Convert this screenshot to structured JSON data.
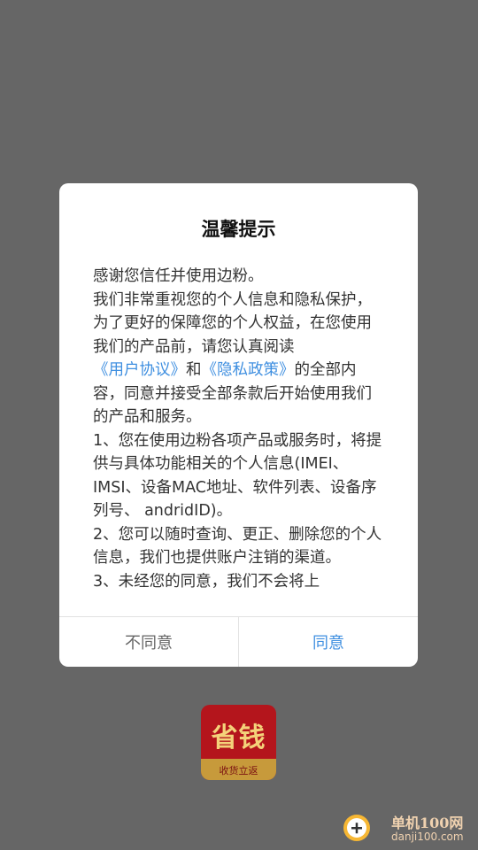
{
  "dialog": {
    "title": "温馨提示",
    "paragraphs": [
      {
        "text": "感谢您信任并使用边粉。"
      },
      {
        "text_before": "我们非常重视您的个人信息和隐私保护，为了更好的保障您的个人权益，在您使用我们的产品前，请您认真阅读",
        "link1": "《用户协议》",
        "middle": "和",
        "link2": "《隐私政策》",
        "text_after": "的全部内容，同意并接受全部条款后开始使用我们的产品和服务。"
      },
      {
        "text": "1、您在使用边粉各项产品或服务时，将提供与具体功能相关的个人信息(IMEI、IMSI、设备MAC地址、软件列表、设备序列号、 andridID)。"
      },
      {
        "text": "2、您可以随时查询、更正、删除您的个人信息，我们也提供账户注销的渠道。"
      },
      {
        "text": "3、未经您的同意，我们不会将上"
      }
    ],
    "disagree_label": "不同意",
    "agree_label": "同意"
  },
  "app_logo": {
    "text": "省钱",
    "subtext": "收货立返"
  },
  "watermark": {
    "name": "单机100网",
    "url": "danji100.com"
  },
  "colors": {
    "overlay": "#666666",
    "link": "#3f8fe0",
    "logo_red": "#b4151c"
  }
}
